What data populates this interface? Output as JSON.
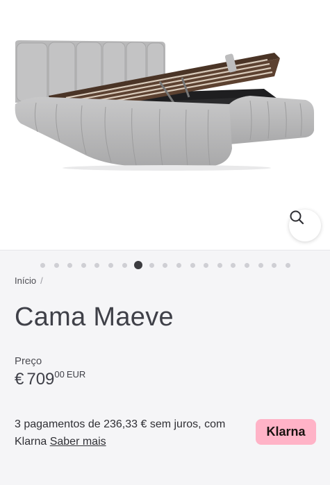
{
  "gallery": {
    "image_alt": "",
    "zoom_icon": "search-icon",
    "dot_count": 19,
    "active_index": 7
  },
  "breadcrumb": {
    "home_label": "Início",
    "separator": "/"
  },
  "product": {
    "title": "Cama Maeve",
    "price_label": "Preço",
    "currency_symbol": "€",
    "price_integer": "709",
    "price_decimal": "00",
    "currency_code": "EUR"
  },
  "klarna": {
    "text": "3 pagamentos de 236,33 € sem juros, com Klarna",
    "link_label": "Saber mais",
    "badge_label": "Klarna",
    "badge_color": "#ffb3c7"
  }
}
